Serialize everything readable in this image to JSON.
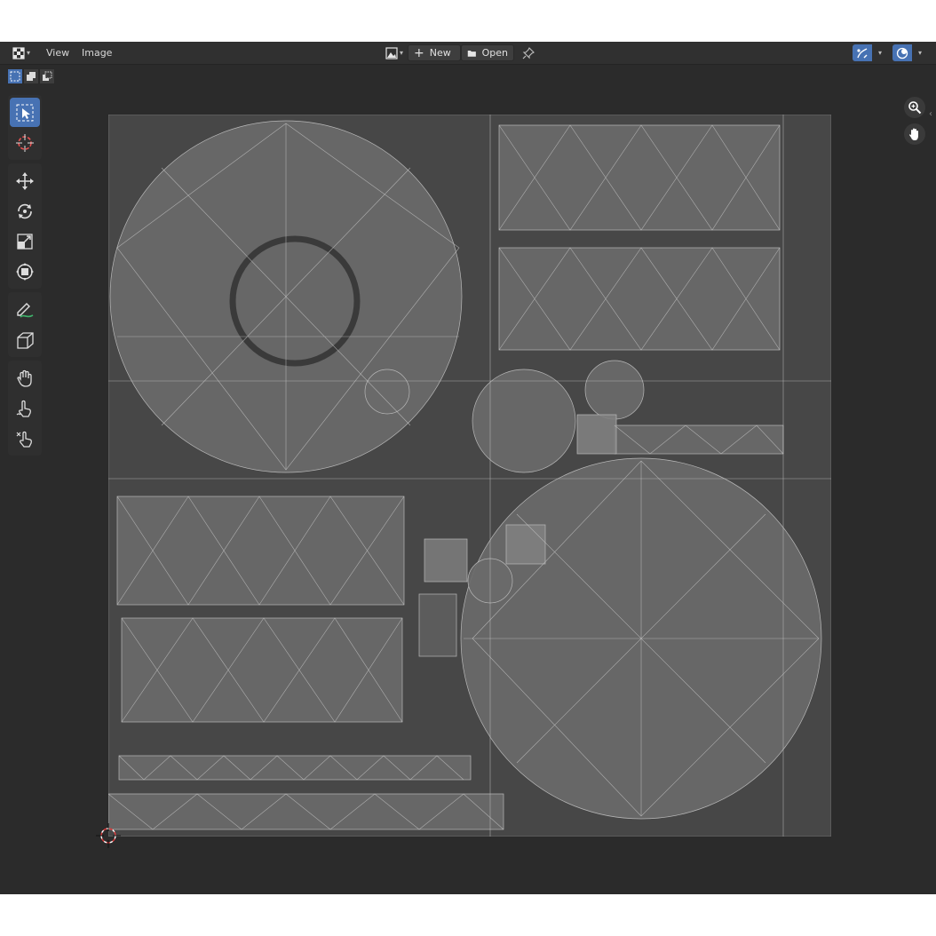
{
  "header": {
    "menu": [
      {
        "label": "View"
      },
      {
        "label": "Image"
      }
    ],
    "new_label": "New",
    "open_label": "Open",
    "editor_type_icon": "uv-image-editor-icon",
    "pin_icon": "pin-icon",
    "gizmo_icon": "uv-sync-icon",
    "overlay_icon": "overlays-icon"
  },
  "subheader": {
    "select_modes": [
      "select-box-new-icon",
      "select-extend-icon",
      "select-subtract-icon"
    ]
  },
  "toolbar": {
    "tools": [
      {
        "name": "select-box-tool",
        "icon": "select-box-icon",
        "active": true
      },
      {
        "name": "cursor-tool",
        "icon": "cursor-icon"
      },
      {
        "name": "move-tool",
        "icon": "move-icon"
      },
      {
        "name": "rotate-tool",
        "icon": "rotate-icon"
      },
      {
        "name": "scale-tool",
        "icon": "scale-icon"
      },
      {
        "name": "transform-tool",
        "icon": "transform-icon"
      },
      {
        "name": "annotate-tool",
        "icon": "annotate-icon"
      },
      {
        "name": "rip-region-tool",
        "icon": "rip-region-icon"
      },
      {
        "name": "grab-tool",
        "icon": "grab-icon"
      },
      {
        "name": "relax-tool",
        "icon": "relax-icon"
      },
      {
        "name": "pinch-tool",
        "icon": "pinch-icon"
      }
    ]
  },
  "nav_gizmo": [
    "zoom-icon",
    "pan-hand-icon"
  ],
  "colors": {
    "editor_bg": "#2b2b2b",
    "header_bg": "#303030",
    "accent": "#4772b3",
    "uv_fill": "#6a6a6a",
    "uv_wire": "#bdbdbd"
  }
}
